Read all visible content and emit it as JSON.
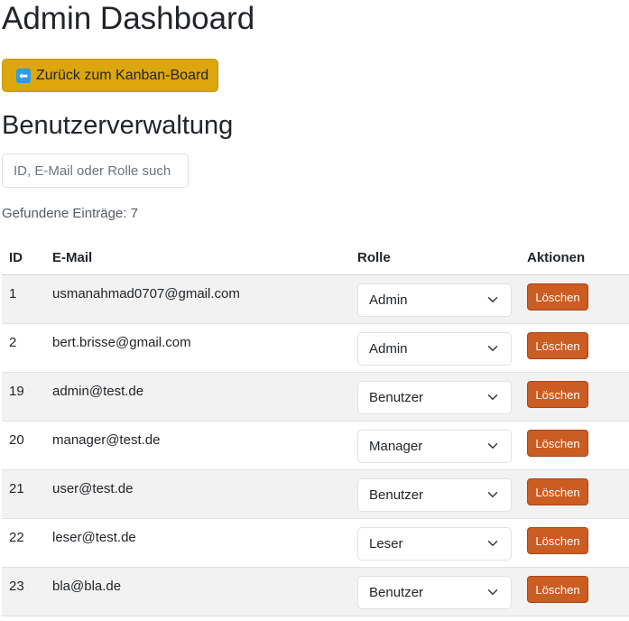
{
  "page": {
    "title": "Admin Dashboard"
  },
  "back_button": {
    "icon": "back-arrow-icon",
    "label": "Zurück zum Kanban-Board"
  },
  "user_management": {
    "title": "Benutzerverwaltung",
    "search": {
      "placeholder": "ID, E-Mail oder Rolle such",
      "value": ""
    },
    "count_label": "Gefundene Einträge: 7",
    "columns": [
      "ID",
      "E-Mail",
      "Rolle",
      "Aktionen"
    ],
    "rows": [
      {
        "id": "1",
        "email": "usmanahmad0707@gmail.com",
        "role": "Admin",
        "action": "Löschen"
      },
      {
        "id": "2",
        "email": "bert.brisse@gmail.com",
        "role": "Admin",
        "action": "Löschen"
      },
      {
        "id": "19",
        "email": "admin@test.de",
        "role": "Benutzer",
        "action": "Löschen"
      },
      {
        "id": "20",
        "email": "manager@test.de",
        "role": "Manager",
        "action": "Löschen"
      },
      {
        "id": "21",
        "email": "user@test.de",
        "role": "Benutzer",
        "action": "Löschen"
      },
      {
        "id": "22",
        "email": "leser@test.de",
        "role": "Leser",
        "action": "Löschen"
      },
      {
        "id": "23",
        "email": "bla@bla.de",
        "role": "Benutzer",
        "action": "Löschen"
      }
    ]
  },
  "colors": {
    "back_button_bg": "#dca60c",
    "delete_button_bg": "#cb5c22",
    "stripe_bg": "#f2f2f2",
    "back_icon_bg": "#2f9be6"
  }
}
